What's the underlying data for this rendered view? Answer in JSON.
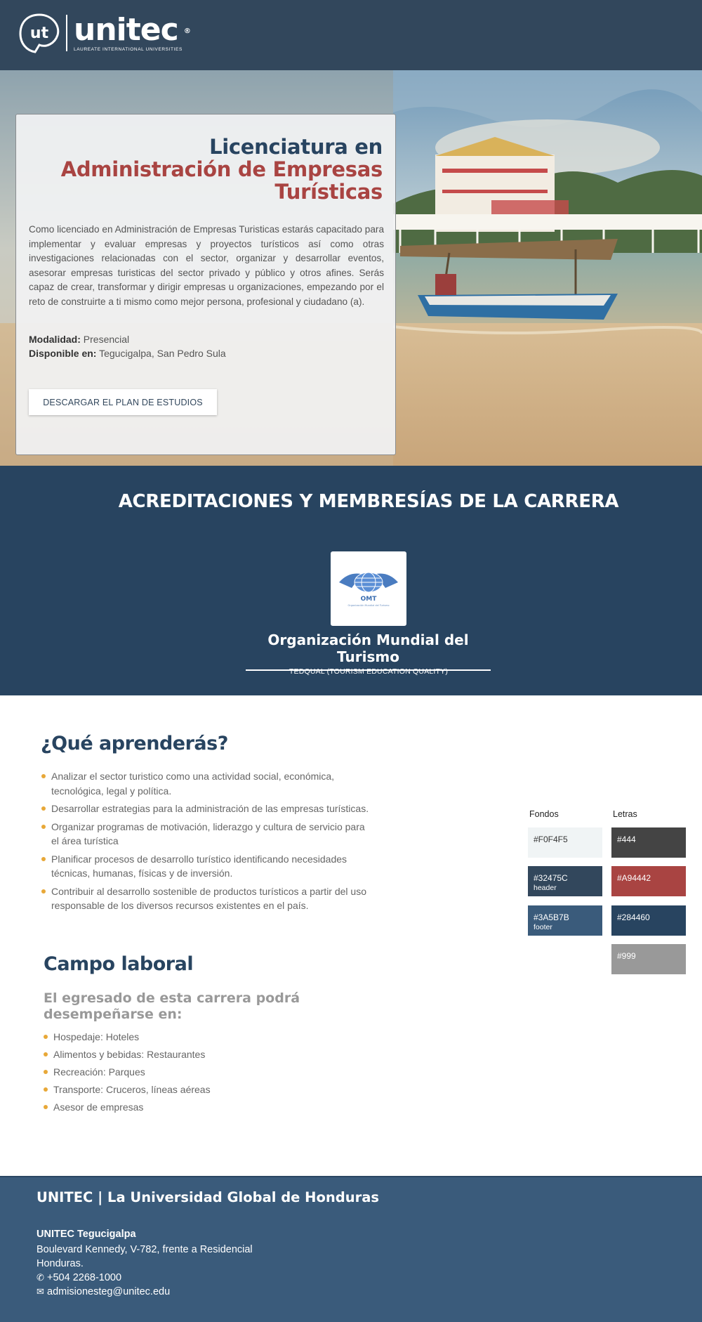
{
  "header": {
    "logo_mark": "ut",
    "logo_word": "unitec",
    "logo_reg": "®",
    "logo_sub": "LAUREATE INTERNATIONAL UNIVERSITIES"
  },
  "hero": {
    "title_line1": "Licenciatura en",
    "title_line2": "Administración de Empresas Turísticas",
    "description": "Como licenciado en Administración de Empresas Turisticas estarás capacitado para implementar y evaluar empresas y proyectos turísticos así como otras investigaciones relacionadas con el sector, organizar y desarrollar eventos, asesorar empresas turisticas del sector privado y público y otros afines. Serás capaz de crear, transformar y dirigir empresas u organizaciones, empezando por el reto de construirte a ti mismo como mejor persona, profesional y ciudadano (a).",
    "modalidad_label": "Modalidad:",
    "modalidad_value": "Presencial",
    "disponible_label": "Disponible en:",
    "disponible_value": "Tegucigalpa, San Pedro Sula",
    "download_button": "DESCARGAR EL PLAN DE ESTUDIOS"
  },
  "accreditations": {
    "title": "ACREDITACIONES Y MEMBRESÍAS DE LA CARRERA",
    "logo_text": "OMT",
    "logo_small": "Organización Mundial del Turismo",
    "org_name": "Organización Mundial del Turismo",
    "org_sub": "TEDQUAL (TOURISM EDUCATION QUALITY)"
  },
  "learn": {
    "title": "¿Qué aprenderás?",
    "items": [
      "Analizar el sector turistico como una actividad social, económica, tecnológica, legal y política.",
      "Desarrollar estrategias para la administración de las empresas turísticas.",
      "Organizar programas de motivación, liderazgo y cultura de servicio para el área turística",
      "Planificar procesos de desarrollo turístico identificando necesidades técnicas, humanas, físicas y de inversión.",
      "Contribuir al desarrollo sostenible de productos turísticos a partir del uso responsable de los diversos recursos existentes en el país."
    ]
  },
  "work": {
    "title": "Campo laboral",
    "subtitle": "El egresado de esta carrera podrá desempeñarse en:",
    "items": [
      "Hospedaje: Hoteles",
      "Alimentos y bebidas: Restaurantes",
      "Recreación: Parques",
      "Transporte: Cruceros, líneas aéreas",
      "Asesor de empresas"
    ]
  },
  "palette": {
    "fondos_label": "Fondos",
    "letras_label": "Letras",
    "fondos": [
      {
        "hex": "#F0F4F5",
        "note": "",
        "bg": "#F0F4F5",
        "fg": "#333333"
      },
      {
        "hex": "#32475C",
        "note": "header",
        "bg": "#32475C",
        "fg": "#ffffff"
      },
      {
        "hex": "#3A5B7B",
        "note": "footer",
        "bg": "#3A5B7B",
        "fg": "#ffffff"
      }
    ],
    "letras": [
      {
        "hex": "#444",
        "bg": "#444444",
        "fg": "#ffffff"
      },
      {
        "hex": "#A94442",
        "bg": "#A94442",
        "fg": "#ffffff"
      },
      {
        "hex": "#284460",
        "bg": "#284460",
        "fg": "#ffffff"
      },
      {
        "hex": "#999",
        "bg": "#999999",
        "fg": "#ffffff"
      }
    ]
  },
  "footer": {
    "title": "UNITEC | La Universidad Global de Honduras",
    "campus": "UNITEC Tegucigalpa",
    "address_line1": "Boulevard Kennedy, V-782, frente a Residencial",
    "address_line2": "Honduras.",
    "phone_icon": "phone-icon",
    "phone": "+504 2268-1000",
    "email_icon": "envelope-icon",
    "email": "admisionesteg@unitec.edu"
  }
}
